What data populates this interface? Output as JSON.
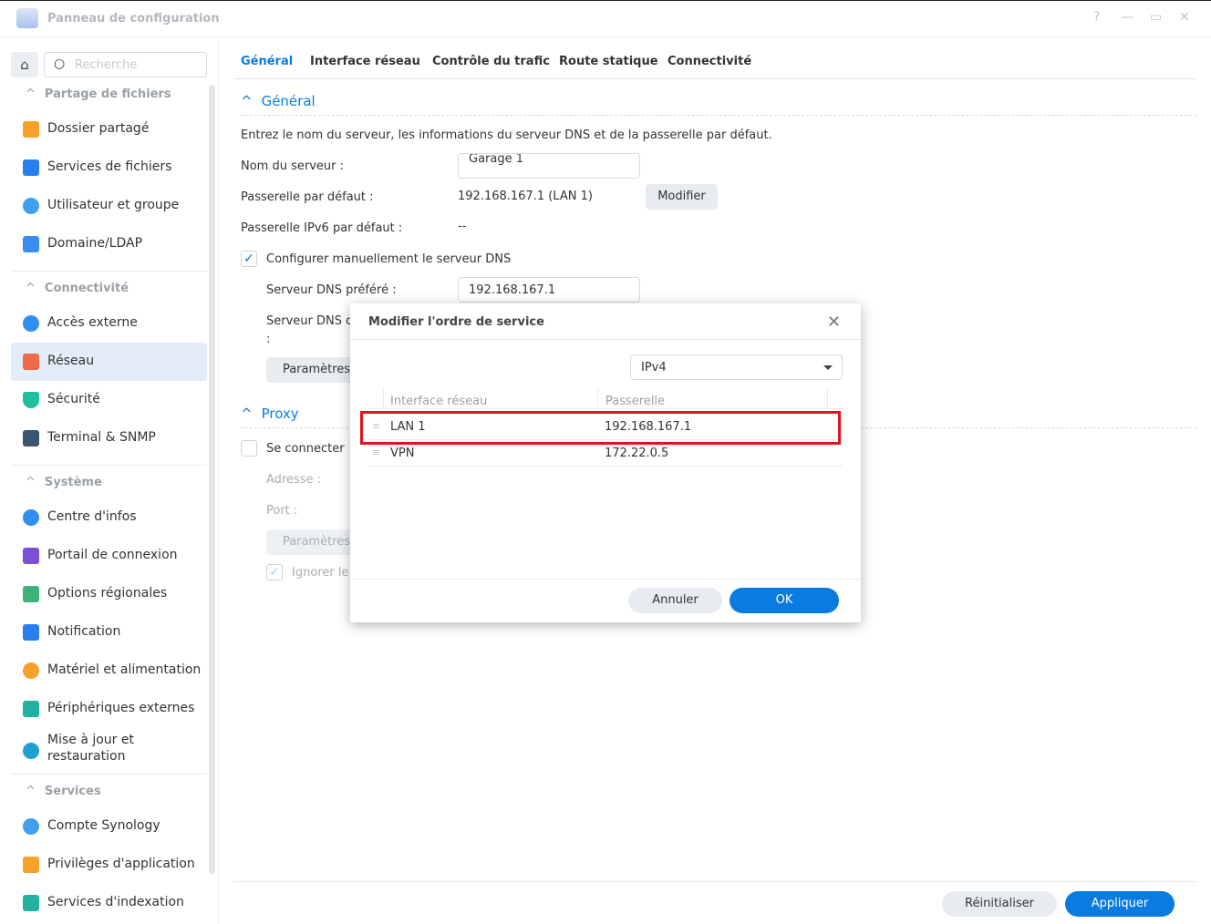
{
  "window": {
    "title": "Panneau de configuration",
    "controls": [
      "?",
      "—",
      "▭",
      "✕"
    ]
  },
  "sidebar": {
    "search_placeholder": "Recherche",
    "sections": [
      {
        "label": "Partage de fichiers",
        "items": [
          "Dossier partagé",
          "Services de fichiers",
          "Utilisateur et groupe",
          "Domaine/LDAP"
        ]
      },
      {
        "label": "Connectivité",
        "items": [
          "Accès externe",
          "Réseau",
          "Sécurité",
          "Terminal & SNMP"
        ]
      },
      {
        "label": "Système",
        "items": [
          "Centre d'infos",
          "Portail de connexion",
          "Options régionales",
          "Notification",
          "Matériel et alimentation",
          "Périphériques externes",
          "Mise à jour et restauration"
        ]
      },
      {
        "label": "Services",
        "items": [
          "Compte Synology",
          "Privilèges d'application",
          "Services d'indexation"
        ]
      }
    ],
    "active_item": "Réseau"
  },
  "tabs": [
    "Général",
    "Interface réseau",
    "Contrôle du trafic",
    "Route statique",
    "Connectivité"
  ],
  "general": {
    "header": "Général",
    "description": "Entrez le nom du serveur, les informations du serveur DNS et de la passerelle par défaut.",
    "server_name_label": "Nom du serveur :",
    "server_name_value": "Garage 1",
    "gateway_label": "Passerelle par défaut :",
    "gateway_value": "192.168.167.1 (LAN 1)",
    "modify_button": "Modifier",
    "ipv6_gateway_label": "Passerelle IPv6 par défaut :",
    "ipv6_gateway_value": "--",
    "manual_dns_label": "Configurer manuellement le serveur DNS",
    "preferred_dns_label": "Serveur DNS préféré :",
    "preferred_dns_value": "192.168.167.1",
    "alt_dns_label": "Serveur DNS d",
    "alt_dns_colon": ":",
    "params_button": "Paramètres"
  },
  "proxy": {
    "header": "Proxy",
    "connect_label": "Se connecter",
    "address_label": "Adresse :",
    "port_label": "Port :",
    "params_button": "Paramètres",
    "ignore_label": "Ignorer le"
  },
  "footer": {
    "reset": "Réinitialiser",
    "apply": "Appliquer"
  },
  "modal": {
    "title": "Modifier l'ordre de service",
    "select_value": "IPv4",
    "columns": [
      "Interface réseau",
      "Passerelle"
    ],
    "rows": [
      {
        "interface": "LAN 1",
        "gateway": "192.168.167.1"
      },
      {
        "interface": "VPN",
        "gateway": "172.22.0.5"
      }
    ],
    "cancel": "Annuler",
    "ok": "OK"
  }
}
